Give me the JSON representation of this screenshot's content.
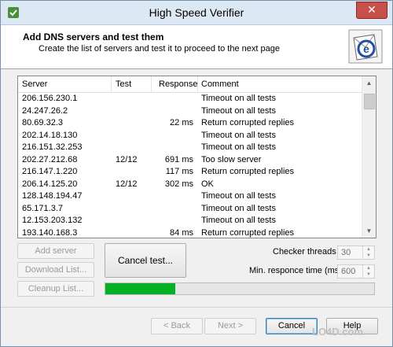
{
  "window": {
    "title": "High Speed Verifier",
    "close_glyph": "✕"
  },
  "header": {
    "heading": "Add DNS servers and test them",
    "subheading": "Create the list of servers and test it to proceed to the next page"
  },
  "list": {
    "columns": [
      "Server",
      "Test",
      "Response",
      "Comment"
    ],
    "rows": [
      {
        "server": "206.156.230.1",
        "test": "",
        "response": "",
        "comment": "Timeout on all tests"
      },
      {
        "server": "24.247.26.2",
        "test": "",
        "response": "",
        "comment": "Timeout on all tests"
      },
      {
        "server": "80.69.32.3",
        "test": "",
        "response": "22 ms",
        "comment": "Return corrupted replies"
      },
      {
        "server": "202.14.18.130",
        "test": "",
        "response": "",
        "comment": "Timeout on all tests"
      },
      {
        "server": "216.151.32.253",
        "test": "",
        "response": "",
        "comment": "Timeout on all tests"
      },
      {
        "server": "202.27.212.68",
        "test": "12/12",
        "response": "691 ms",
        "comment": "Too slow server"
      },
      {
        "server": "216.147.1.220",
        "test": "",
        "response": "117 ms",
        "comment": "Return corrupted replies"
      },
      {
        "server": "206.14.125.20",
        "test": "12/12",
        "response": "302 ms",
        "comment": "OK"
      },
      {
        "server": "128.148.194.47",
        "test": "",
        "response": "",
        "comment": "Timeout on all tests"
      },
      {
        "server": "65.171.3.7",
        "test": "",
        "response": "",
        "comment": "Timeout on all tests"
      },
      {
        "server": "12.153.203.132",
        "test": "",
        "response": "",
        "comment": "Timeout on all tests"
      },
      {
        "server": "193.140.168.3",
        "test": "",
        "response": "84 ms",
        "comment": "Return corrupted replies"
      }
    ]
  },
  "buttons": {
    "add_server": "Add server",
    "download_list": "Download List...",
    "cleanup_list": "Cleanup List...",
    "cancel_test": "Cancel test...",
    "back": "< Back",
    "next": "Next >",
    "cancel": "Cancel",
    "help": "Help"
  },
  "settings": {
    "checker_threads_label": "Checker threads :",
    "checker_threads_value": "30",
    "min_response_label": "Min. responce time (ms):",
    "min_response_value": "600"
  },
  "progress": {
    "fraction": 0.26
  },
  "watermark": "LO4D.com",
  "colors": {
    "progress_fill": "#06b025",
    "title_bar": "#dde8f5",
    "close_button": "#c7504a"
  }
}
